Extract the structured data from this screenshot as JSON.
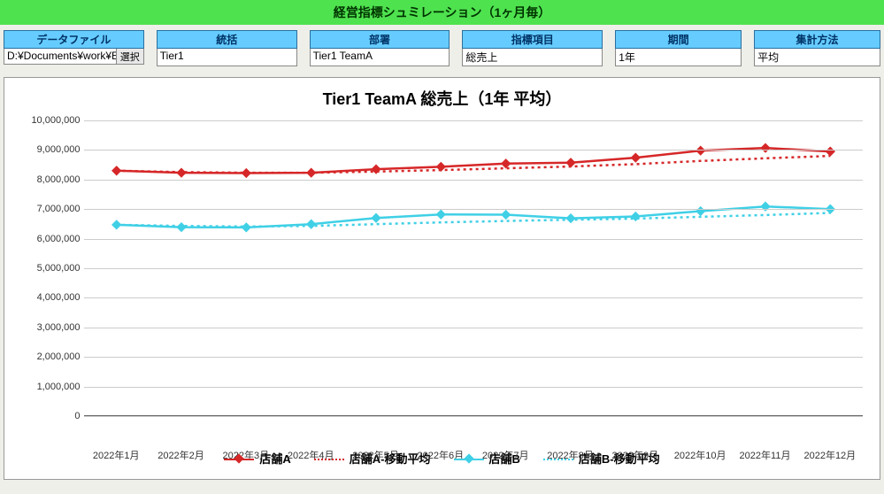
{
  "title": "経営指標シュミレーション（1ヶ月毎）",
  "filters": {
    "datafile": {
      "label": "データファイル",
      "value": "D:¥Documents¥work¥E",
      "button": "選択"
    },
    "summary": {
      "label": "統括",
      "value": "Tier1"
    },
    "dept": {
      "label": "部署",
      "value": "Tier1 TeamA"
    },
    "metric": {
      "label": "指標項目",
      "value": "総売上"
    },
    "period": {
      "label": "期間",
      "value": "1年"
    },
    "agg": {
      "label": "集計方法",
      "value": "平均"
    }
  },
  "chart": {
    "title": "Tier1 TeamA 総売上（1年 平均）",
    "legend": {
      "storeA": "店舗A",
      "storeA_ma": "店舗A-移動平均",
      "storeB": "店舗B",
      "storeB_ma": "店舗B-移動平均"
    }
  },
  "colors": {
    "red": "#d62728",
    "cyan": "#3fd0e6"
  },
  "chart_data": {
    "type": "line",
    "title": "Tier1 TeamA 総売上（1年 平均）",
    "xlabel": "",
    "ylabel": "",
    "ylim": [
      0,
      10000000
    ],
    "yticks": [
      0,
      1000000,
      2000000,
      3000000,
      4000000,
      5000000,
      6000000,
      7000000,
      8000000,
      9000000,
      10000000
    ],
    "ytick_labels": [
      "0",
      "1,000,000",
      "2,000,000",
      "3,000,000",
      "4,000,000",
      "5,000,000",
      "6,000,000",
      "7,000,000",
      "8,000,000",
      "9,000,000",
      "10,000,000"
    ],
    "categories": [
      "2022年1月",
      "2022年2月",
      "2022年3月",
      "2022年4月",
      "2022年5月",
      "2022年6月",
      "2022年7月",
      "2022年8月",
      "2022年9月",
      "2022年10月",
      "2022年11月",
      "2022年12月"
    ],
    "series": [
      {
        "name": "店舗A",
        "style": "solid-marker",
        "color": "#d62728",
        "values": [
          8300000,
          8230000,
          8220000,
          8230000,
          8350000,
          8430000,
          8540000,
          8570000,
          8740000,
          8980000,
          9070000,
          8950000
        ]
      },
      {
        "name": "店舗A-移動平均",
        "style": "dotted",
        "color": "#d62728",
        "values": [
          8300000,
          8250000,
          8230000,
          8230000,
          8270000,
          8320000,
          8380000,
          8440000,
          8520000,
          8630000,
          8720000,
          8800000
        ]
      },
      {
        "name": "店舗B",
        "style": "solid-marker",
        "color": "#3fd0e6",
        "values": [
          6470000,
          6390000,
          6380000,
          6490000,
          6700000,
          6820000,
          6810000,
          6690000,
          6750000,
          6930000,
          7090000,
          7000000
        ]
      },
      {
        "name": "店舗B-移動平均",
        "style": "dotted",
        "color": "#3fd0e6",
        "values": [
          6470000,
          6430000,
          6410000,
          6430000,
          6490000,
          6550000,
          6600000,
          6640000,
          6680000,
          6740000,
          6800000,
          6870000
        ]
      }
    ]
  }
}
